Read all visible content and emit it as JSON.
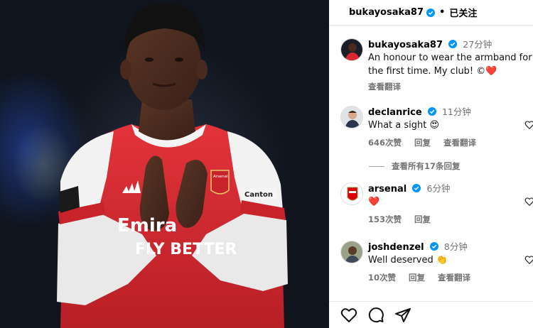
{
  "header": {
    "username": "bukayosaka87",
    "separator": "•",
    "follow_label": "已关注"
  },
  "caption": {
    "username": "bukayosaka87",
    "time": "27分钟",
    "text": "An honour to wear the armband for the first time. My club! ©❤️",
    "translate_label": "查看翻译"
  },
  "comments": [
    {
      "username": "declanrice",
      "time": "11分钟",
      "text": "What a sight 😍",
      "likes": "646次赞",
      "reply": "回复",
      "translate": "查看翻译"
    },
    {
      "username": "arsenal",
      "time": "6分钟",
      "text": "❤️",
      "likes": "153次赞",
      "reply": "回复"
    },
    {
      "username": "joshdenzel",
      "time": "8分钟",
      "text": "Well deserved 👏",
      "likes": "10次赞",
      "reply": "回复",
      "translate": "查看翻译"
    }
  ],
  "view_replies": "查看所有17条回复",
  "photo": {
    "shirt_text_1": "Emira",
    "shirt_text_2": "FLY BETTER",
    "sleeve_sponsor": "Canton",
    "crest_text": "Arsenal"
  },
  "icons": [
    "verified-badge-icon",
    "heart-icon",
    "comment-icon",
    "share-icon"
  ],
  "colors": {
    "verified": "#0095f6",
    "shirt_red": "#d9282f",
    "muted": "#737373"
  }
}
